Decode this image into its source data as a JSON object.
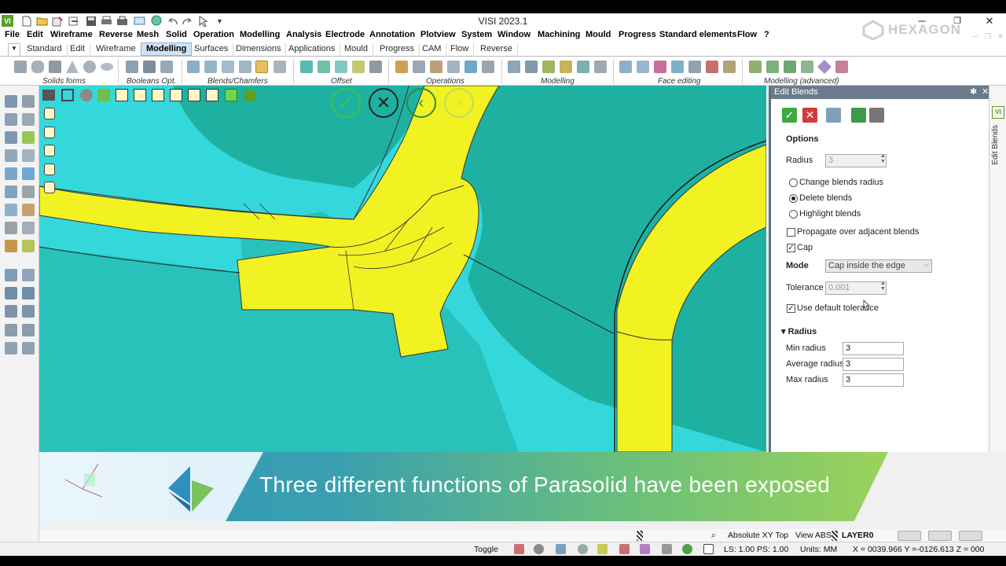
{
  "app": {
    "title": "VISI 2023.1",
    "brand": "HEXAGON",
    "window_controls": [
      "minimize-icon",
      "restore-icon",
      "close-icon"
    ]
  },
  "menu": [
    "File",
    "Edit",
    "Wireframe",
    "Reverse",
    "Mesh",
    "Solid",
    "Operation",
    "Modelling",
    "Analysis",
    "Electrode",
    "Annotation",
    "Plotview",
    "System",
    "Window",
    "Machining",
    "Mould",
    "Progress",
    "Standard elements",
    "Flow",
    "?"
  ],
  "tabs": [
    "Standard",
    "Edit",
    "Wireframe",
    "Modelling",
    "Surfaces",
    "Dimensions",
    "Applications",
    "Mould",
    "Progress",
    "CAM",
    "Flow",
    "Reverse"
  ],
  "active_tab": "Modelling",
  "ribbon_groups": [
    "Solids forms",
    "Booleans Opt.",
    "Blends/Chamfers",
    "Offset",
    "Operations",
    "Modelling",
    "Face editing",
    "Modelling (advanced)"
  ],
  "panel": {
    "title": "Edit Blends",
    "side_label": "Edit Blends",
    "options_heading": "Options",
    "radius_label": "Radius",
    "radius_value": "3",
    "modes": [
      "Change blends radius",
      "Delete blends",
      "Highlight blends"
    ],
    "selected_mode": "Delete blends",
    "propagate_label": "Propagate over adjacent blends",
    "propagate_checked": false,
    "cap_label": "Cap",
    "cap_checked": true,
    "mode_label": "Mode",
    "mode_value": "Cap inside the edge",
    "tolerance_label": "Tolerance",
    "tolerance_value": "0.001",
    "default_tol_label": "Use default tolerance",
    "default_tol_checked": true,
    "radius_section": "Radius",
    "min_radius_label": "Min radius",
    "min_radius": "3",
    "avg_radius_label": "Average radius",
    "avg_radius": "3",
    "max_radius_label": "Max radius",
    "max_radius": "3"
  },
  "banner": {
    "text": "Three different functions of Parasolid have been exposed"
  },
  "status": {
    "view_mode": "Absolute XY Top",
    "view_abs": "View ABS",
    "layer": "LAYER0",
    "toggle": "Toggle",
    "ls_ps": "LS: 1.00 PS: 1.00",
    "units": "Units: MM",
    "coords": "X = 0039.966 Y =-0126.613 Z = 000"
  },
  "colors": {
    "viewport_bg": "#35d8da",
    "dark_face": "#1fb3a3",
    "yellow_face": "#f2f222",
    "panel_header": "#6a7b8c"
  }
}
